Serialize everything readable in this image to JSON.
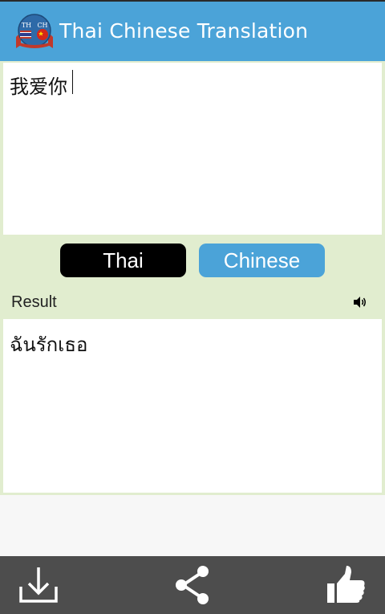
{
  "app_bar": {
    "title": "Thai Chinese Translation",
    "logo_text_left": "TH",
    "logo_text_right": "CH"
  },
  "input": {
    "value": "我爱你"
  },
  "language_buttons": {
    "thai_label": "Thai",
    "chinese_label": "Chinese",
    "selected": "Thai"
  },
  "result": {
    "label": "Result",
    "value": "ฉันรักเธอ",
    "speaker_icon": "speaker-icon"
  },
  "toolbar": {
    "icons": [
      "download-icon",
      "share-icon",
      "thumbs-up-icon"
    ]
  },
  "colors": {
    "accent": "#4ba3d8",
    "content_bg": "#e1edcf",
    "bottom_bar": "#4d4d4d",
    "selected_button": "#000000"
  }
}
